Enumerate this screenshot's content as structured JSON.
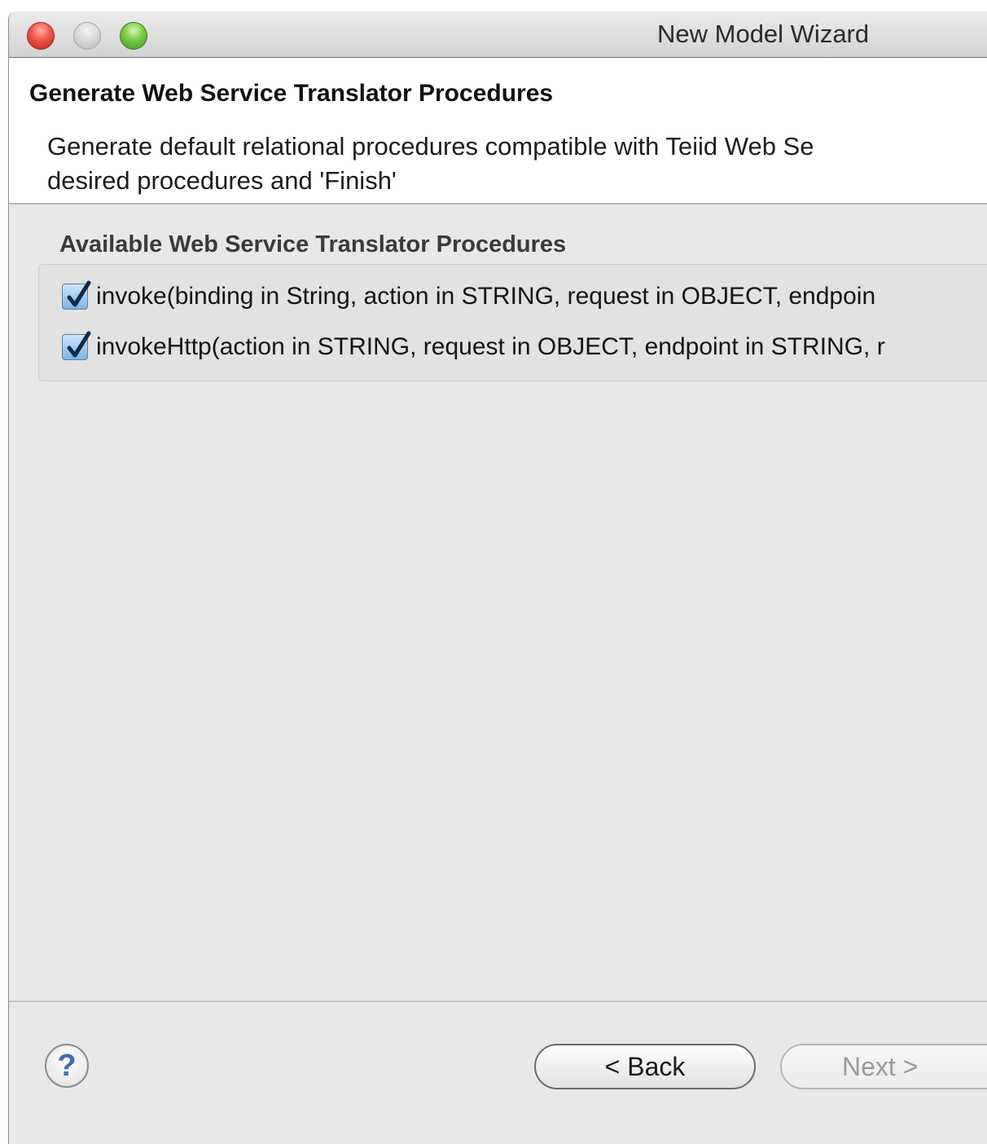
{
  "window": {
    "title": "New Model Wizard"
  },
  "header": {
    "page_title": "Generate Web Service Translator Procedures",
    "description_line1": "Generate default relational procedures compatible with Teiid Web Se",
    "description_line2": "desired procedures and 'Finish'"
  },
  "procedures": {
    "group_label": "Available Web Service Translator Procedures",
    "items": [
      {
        "label": "invoke(binding in String, action in STRING, request in OBJECT, endpoin",
        "checked": true
      },
      {
        "label": "invokeHttp(action in STRING, request in OBJECT, endpoint in STRING, r",
        "checked": true
      }
    ]
  },
  "footer": {
    "help_symbol": "?",
    "back_label": "< Back",
    "next_label": "Next >",
    "next_enabled": false
  }
}
